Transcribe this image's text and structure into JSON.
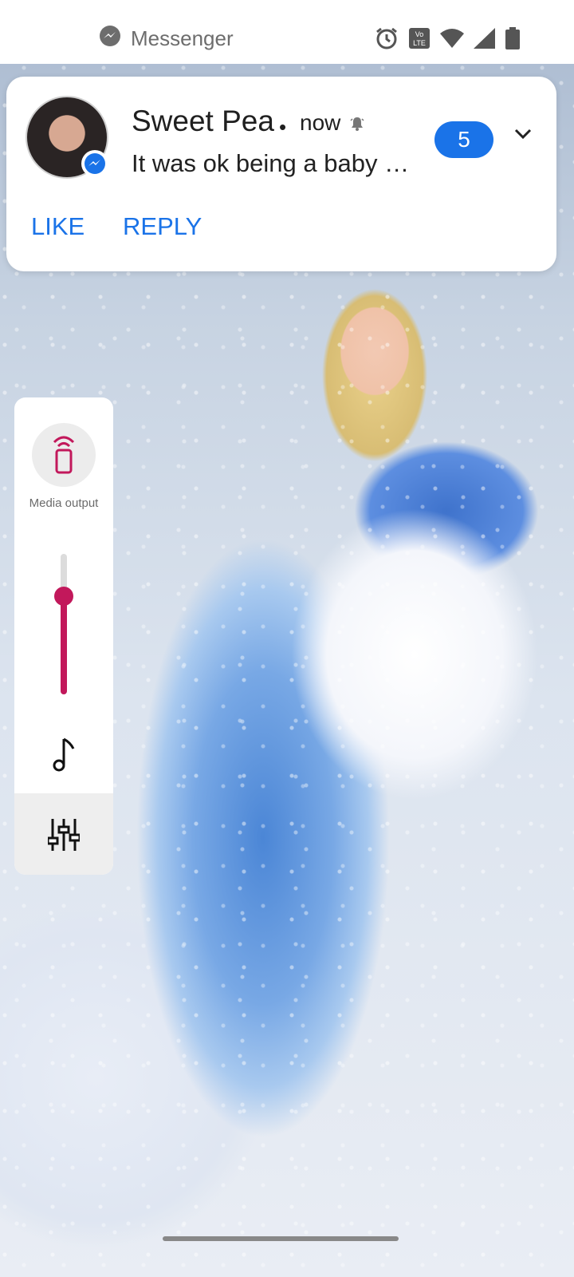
{
  "status_bar": {
    "app_name": "Messenger",
    "icons": [
      "messenger-icon",
      "alarm-icon",
      "volte-icon",
      "wifi-icon",
      "cell-signal-icon",
      "battery-icon"
    ]
  },
  "notification": {
    "sender": "Sweet Pea",
    "separator": "•",
    "time": "now",
    "message": "It was ok being a baby …",
    "count": "5",
    "actions": {
      "like": "LIKE",
      "reply": "REPLY"
    },
    "colors": {
      "accent": "#1a73e8"
    }
  },
  "volume_panel": {
    "media_output_label": "Media output",
    "volume_level": 0.7,
    "accent": "#c2185b"
  }
}
